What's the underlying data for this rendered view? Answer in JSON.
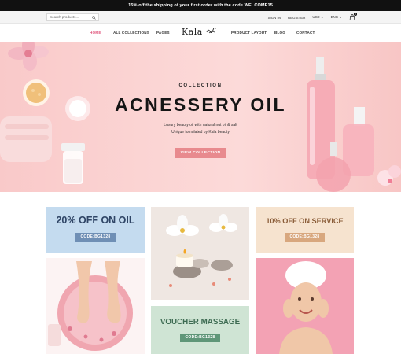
{
  "topbar": {
    "announcement": "15% off the shipping of your first order with the code WELCOME15"
  },
  "utilbar": {
    "search_placeholder": "Search products...",
    "signin": "SIGN IN",
    "register": "REGISTER",
    "currency": "USD ⌄",
    "language": "ENG ⌄",
    "cart_count": "0"
  },
  "nav": {
    "home": "HOME",
    "all_collections": "ALL COLLECTIONS",
    "pages": "PAGES",
    "logo": "Kala",
    "product_layout": "PRODUCT LAYOUT",
    "blog": "BLOG",
    "contact": "CONTACT"
  },
  "hero": {
    "subtitle": "COLLECTION",
    "title": "ACNESSERY OIL",
    "desc_line1": "Luxury beauty oil with natural nut oil & salt",
    "desc_line2": "Unique fomulated by Kala beauty",
    "button": "VIEW COLLECTION"
  },
  "promos": {
    "oil": {
      "title": "20% OFF ON OIL",
      "code": "CODE:BG1328"
    },
    "service": {
      "title": "10% OFF ON SERVICE",
      "code": "CODE:BG1328"
    },
    "voucher": {
      "title": "VOUCHER MASSAGE",
      "code": "CODE:BG1328"
    }
  },
  "colors": {
    "accent": "#e0567c",
    "hero_button": "#e88a8e",
    "oil_tile": "#c4dbef",
    "oil_code": "#6f8fb5",
    "service_tile": "#f6e3cf",
    "service_code": "#d8a77e",
    "voucher_tile": "#cfe4d4",
    "voucher_code": "#5f9678"
  }
}
